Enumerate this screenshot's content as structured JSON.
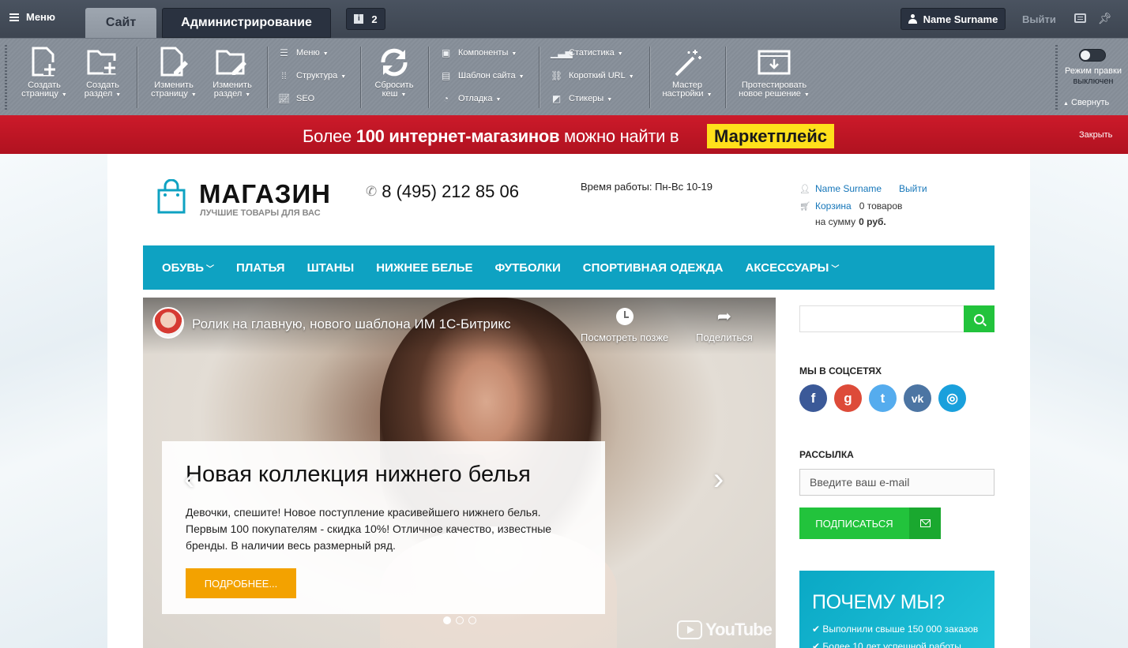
{
  "admin": {
    "menu_label": "Меню",
    "tabs": [
      {
        "label": "Сайт"
      },
      {
        "label": "Администрирование"
      }
    ],
    "notifications_count": "2",
    "user_name": "Name Surname",
    "logout": "Выйти"
  },
  "toolbar": {
    "big": [
      {
        "label": "Создать страницу",
        "icon": "create-page-icon"
      },
      {
        "label": "Создать раздел",
        "icon": "create-section-icon"
      },
      {
        "label": "Изменить страницу",
        "icon": "edit-page-icon"
      },
      {
        "label": "Изменить раздел",
        "icon": "edit-section-icon"
      },
      {
        "label": "Сбросить кеш",
        "icon": "refresh-icon"
      },
      {
        "label": "Мастер настройки",
        "icon": "magic-wand-icon"
      },
      {
        "label": "Протестировать новое решение",
        "icon": "test-solution-icon"
      }
    ],
    "menu_group": [
      "Меню",
      "Структура",
      "SEO"
    ],
    "components_group": [
      "Компоненты",
      "Шаблон сайта",
      "Отладка"
    ],
    "stats_group": [
      "Статистика",
      "Короткий URL",
      "Стикеры"
    ],
    "edit_mode_label": "Режим правки",
    "edit_mode_state": "выключен",
    "collapse_label": "Свернуть"
  },
  "banner": {
    "text_prefix": "Более ",
    "text_bold": "100 интернет-магазинов",
    "text_suffix": " можно найти в",
    "highlight": "Маркетплейс",
    "close": "Закрыть"
  },
  "header": {
    "logo_title": "МАГАЗИН",
    "logo_subtitle": "ЛУЧШИЕ ТОВАРЫ ДЛЯ ВАС",
    "phone": "8 (495) 212 85 06",
    "hours": "Время работы: Пн-Вс 10-19",
    "user_name": "Name Surname",
    "logout": "Выйти",
    "cart_label": "Корзина",
    "cart_items": "0 товаров",
    "cart_sum_label": "на сумму ",
    "cart_sum": "0 руб."
  },
  "nav": [
    {
      "label": "ОБУВЬ",
      "dropdown": true
    },
    {
      "label": "ПЛАТЬЯ",
      "dropdown": false
    },
    {
      "label": "ШТАНЫ",
      "dropdown": false
    },
    {
      "label": "НИЖНЕЕ БЕЛЬЕ",
      "dropdown": false
    },
    {
      "label": "ФУТБОЛКИ",
      "dropdown": false
    },
    {
      "label": "СПОРТИВНАЯ ОДЕЖДА",
      "dropdown": false
    },
    {
      "label": "АКСЕССУАРЫ",
      "dropdown": true
    }
  ],
  "slider": {
    "video_title": "Ролик на главную, нового шаблона ИМ 1С-Битрикс",
    "watch_later": "Посмотреть позже",
    "share": "Поделиться",
    "title": "Новая коллекция нижнего белья",
    "text": "Девочки, спешите! Новое поступление красивейшего нижнего белья. Первым 100 покупателям - скидка 10%! Отличное качество, известные бренды. В наличии весь размерный ряд.",
    "button": "ПОДРОБНЕЕ...",
    "youtube": "YouTube",
    "active_slide": 1,
    "slides_count": 3
  },
  "sidebar": {
    "search_placeholder": "",
    "social_title": "МЫ В СОЦСЕТЯХ",
    "socials": [
      {
        "name": "facebook-icon",
        "glyph": "f",
        "color": "#3b5998"
      },
      {
        "name": "google-plus-icon",
        "glyph": "g",
        "color": "#dd4b39"
      },
      {
        "name": "twitter-icon",
        "glyph": "t",
        "color": "#55acee"
      },
      {
        "name": "vk-icon",
        "glyph": "vk",
        "color": "#4c75a3"
      },
      {
        "name": "instagram-icon",
        "glyph": "◎",
        "color": "#1aa0dc"
      }
    ],
    "newsletter_title": "РАССЫЛКА",
    "email_placeholder": "Введите ваш e-mail",
    "subscribe": "ПОДПИСАТЬСЯ",
    "why_title": "ПОЧЕМУ МЫ?",
    "why_items": [
      "✔ Выполнили свыше 150 000 заказов",
      "✔ Более 10 лет успешной работы"
    ]
  },
  "colors": {
    "admin_bg": "#3d4551",
    "banner_red": "#cc1a2a",
    "marketplace_yellow": "#ffe01b",
    "nav_blue": "#0ea2c2",
    "accent_green": "#22c33c",
    "button_orange": "#f3a200"
  }
}
